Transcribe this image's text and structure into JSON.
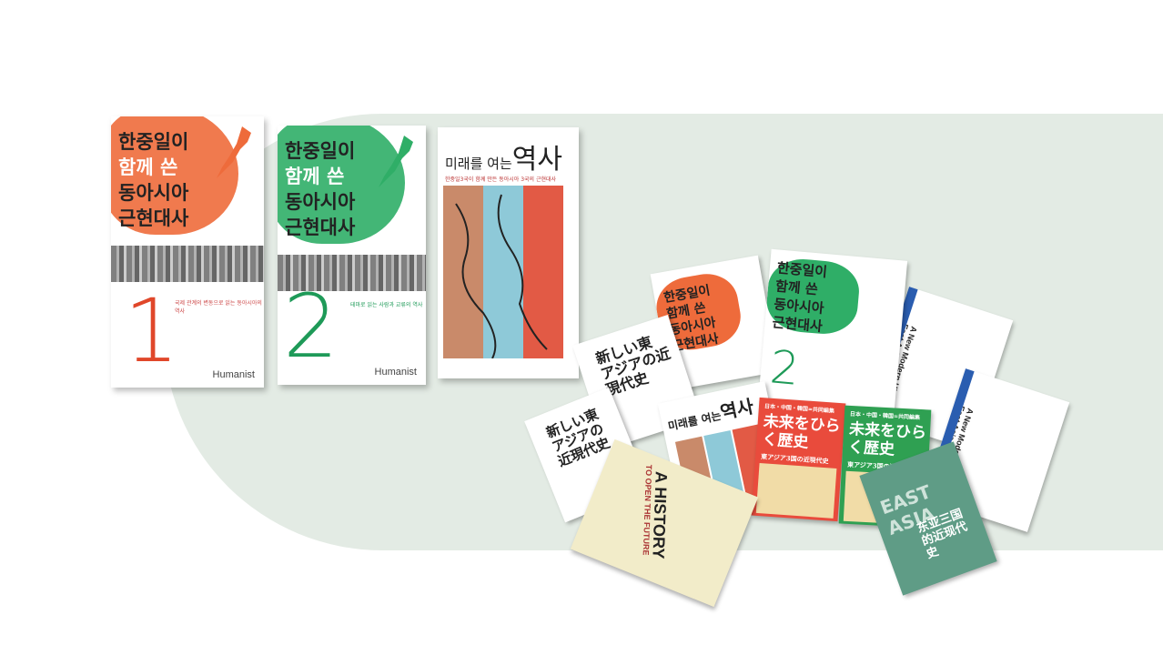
{
  "books": [
    {
      "title_lines": [
        "한중일이",
        "함께 쓴",
        "동아시아",
        "근현대사"
      ],
      "volume": "1",
      "publisher": "Humanist",
      "subtitle": "국제 관계의 변동으로 읽는 동아시아의 역사",
      "color": "#ee6b3b"
    },
    {
      "title_lines": [
        "한중일이",
        "함께 쓴",
        "동아시아",
        "근현대사"
      ],
      "volume": "2",
      "publisher": "Humanist",
      "subtitle": "테마로 읽는 사람과 교류의 역사",
      "color": "#2fae67"
    },
    {
      "title_small": "미래를 여는",
      "title_big": "역사",
      "subtitle": "한중일3국이 함께 만든 동아시아 3국의 근현대사"
    }
  ],
  "collage": {
    "jp_title": "新しい東アジアの近現代史",
    "cn_title": "未来をひらく歴史",
    "cn_sub": "東アジア3国の近現代史",
    "en_title_1": "A HISTORY",
    "en_title_2": "TO OPEN THE FUTURE",
    "en_modern": "A New Modern History of East Asia",
    "zh_title": "东亚三国的近现代史",
    "east_asia": "EAST ASIA",
    "kr_small": "미래를 여는",
    "kr_big": "역사",
    "vol2": "2",
    "series_label": "日本・中国・韓国=共同編集",
    "kr_lines": [
      "한중일이",
      "함께 쓴",
      "동아시아",
      "근현대사"
    ]
  }
}
